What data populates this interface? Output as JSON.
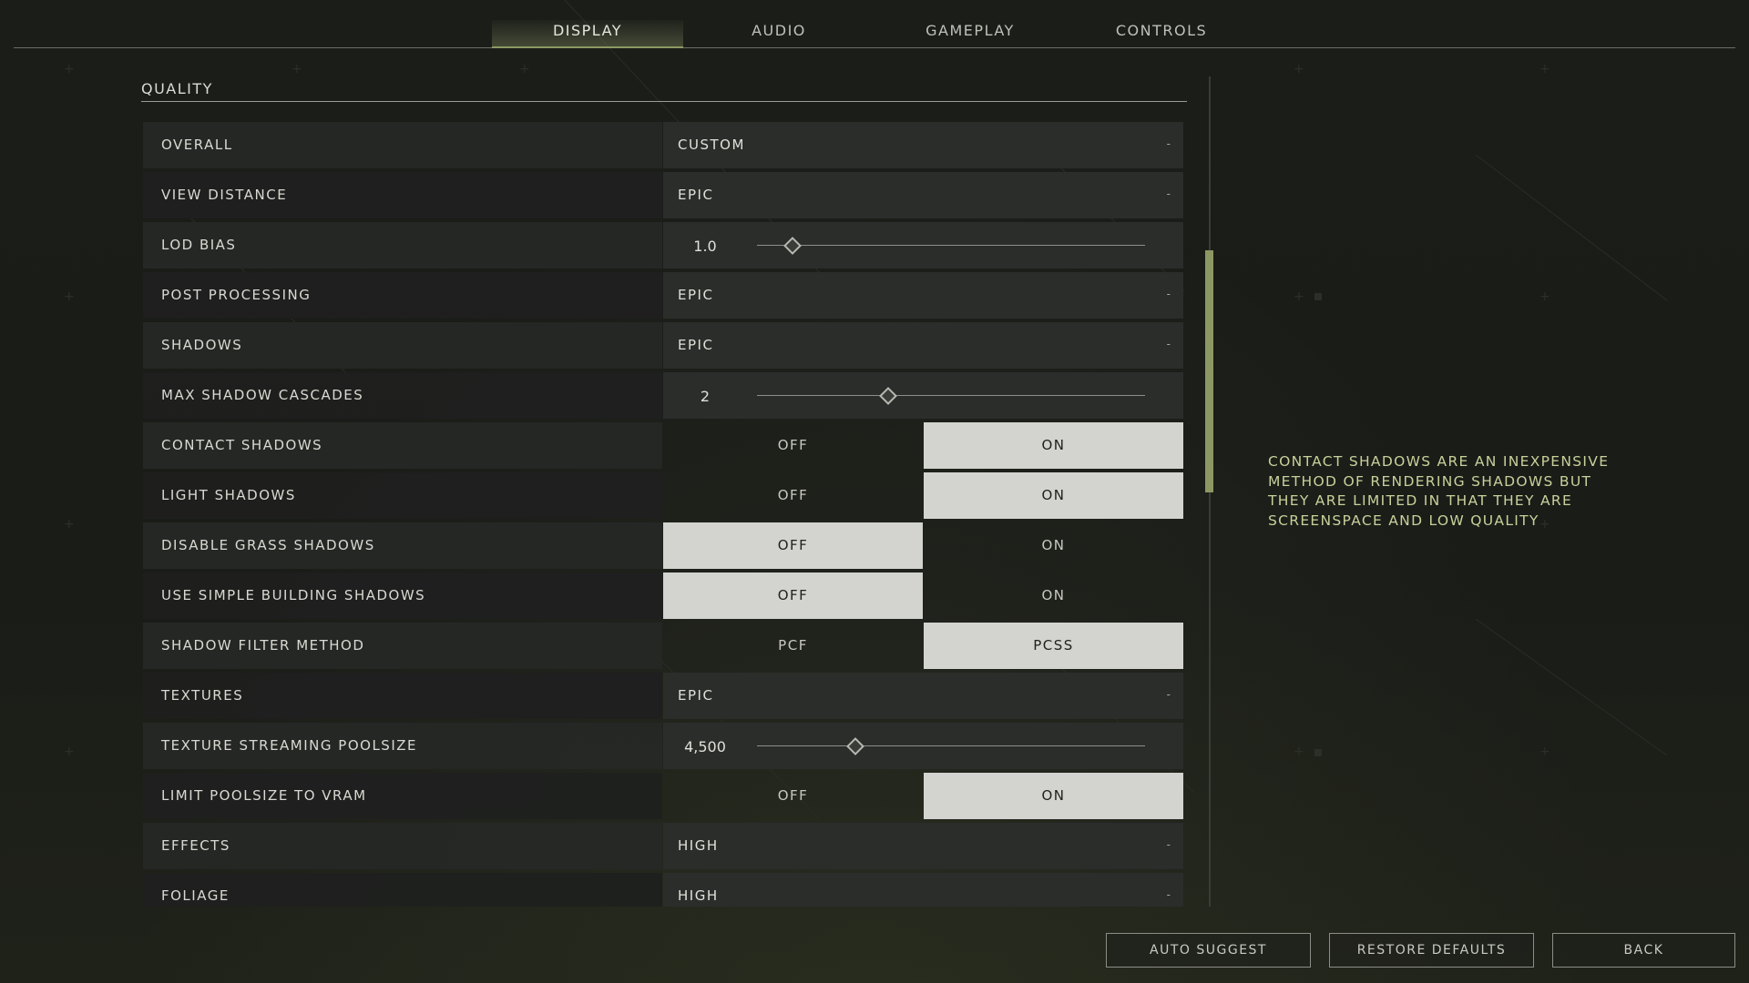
{
  "tabs": [
    {
      "label": "DISPLAY",
      "active": true
    },
    {
      "label": "AUDIO",
      "active": false
    },
    {
      "label": "GAMEPLAY",
      "active": false
    },
    {
      "label": "CONTROLS",
      "active": false
    }
  ],
  "section": {
    "title": "QUALITY"
  },
  "settings": [
    {
      "label": "OVERALL",
      "type": "dropdown",
      "value": "CUSTOM",
      "caret": "-"
    },
    {
      "label": "VIEW DISTANCE",
      "type": "dropdown",
      "value": "EPIC",
      "caret": "-"
    },
    {
      "label": "LOD BIAS",
      "type": "slider",
      "value": "1.0",
      "fraction": 0.09
    },
    {
      "label": "POST PROCESSING",
      "type": "dropdown",
      "value": "EPIC",
      "caret": "-"
    },
    {
      "label": "SHADOWS",
      "type": "dropdown",
      "value": "EPIC",
      "caret": "-"
    },
    {
      "label": "MAX SHADOW CASCADES",
      "type": "slider",
      "value": "2",
      "fraction": 0.335
    },
    {
      "label": "CONTACT SHADOWS",
      "type": "toggle",
      "options": [
        "OFF",
        "ON"
      ],
      "selected": 1
    },
    {
      "label": "LIGHT SHADOWS",
      "type": "toggle",
      "options": [
        "OFF",
        "ON"
      ],
      "selected": 1
    },
    {
      "label": "DISABLE GRASS SHADOWS",
      "type": "toggle",
      "options": [
        "OFF",
        "ON"
      ],
      "selected": 0
    },
    {
      "label": "USE SIMPLE BUILDING SHADOWS",
      "type": "toggle",
      "options": [
        "OFF",
        "ON"
      ],
      "selected": 0
    },
    {
      "label": "SHADOW FILTER METHOD",
      "type": "toggle",
      "options": [
        "PCF",
        "PCSS"
      ],
      "selected": 1
    },
    {
      "label": "TEXTURES",
      "type": "dropdown",
      "value": "EPIC",
      "caret": "-"
    },
    {
      "label": "TEXTURE STREAMING POOLSIZE",
      "type": "slider",
      "value": "4,500",
      "fraction": 0.25
    },
    {
      "label": "LIMIT POOLSIZE TO VRAM",
      "type": "toggle",
      "options": [
        "OFF",
        "ON"
      ],
      "selected": 1
    },
    {
      "label": "EFFECTS",
      "type": "dropdown",
      "value": "HIGH",
      "caret": "-"
    },
    {
      "label": "FOLIAGE",
      "type": "dropdown",
      "value": "HIGH",
      "caret": "-"
    }
  ],
  "scrollbar": {
    "position": 0.24,
    "visible_fraction": 0.29
  },
  "description": "CONTACT SHADOWS ARE AN INEXPENSIVE METHOD OF RENDERING SHADOWS BUT THEY ARE LIMITED IN THAT THEY ARE SCREENSPACE AND LOW QUALITY",
  "footer": {
    "auto_suggest": "AUTO SUGGEST",
    "restore_defaults": "RESTORE DEFAULTS",
    "back": "BACK"
  },
  "colors": {
    "accent": "#8b9863",
    "description_text": "#c9d09a",
    "selected_option": "#d3d3d0"
  }
}
